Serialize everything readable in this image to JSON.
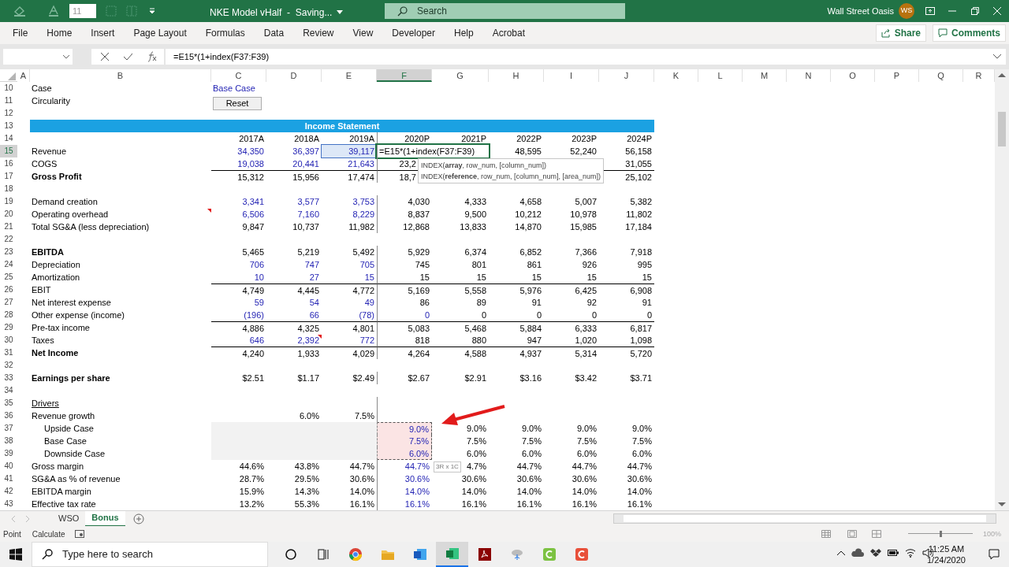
{
  "title_bar": {
    "font_size": "11",
    "title": "NKE Model vHalf  -  Saving...",
    "search": "Search",
    "user": "Wall Street Oasis",
    "initials": "WS"
  },
  "ribbon_tabs": [
    "File",
    "Home",
    "Insert",
    "Page Layout",
    "Formulas",
    "Data",
    "Review",
    "View",
    "Developer",
    "Help",
    "Acrobat"
  ],
  "ribbon_buttons": {
    "share": "Share",
    "comments": "Comments"
  },
  "formula_bar": {
    "formula": "=E15*(1+index(F37:F39)"
  },
  "columns": [
    {
      "letter": "A",
      "selected": false
    },
    {
      "letter": "B",
      "selected": false
    },
    {
      "letter": "C",
      "selected": false
    },
    {
      "letter": "D",
      "selected": false
    },
    {
      "letter": "E",
      "selected": false
    },
    {
      "letter": "F",
      "selected": true
    },
    {
      "letter": "G",
      "selected": false
    },
    {
      "letter": "H",
      "selected": false
    },
    {
      "letter": "I",
      "selected": false
    },
    {
      "letter": "J",
      "selected": false
    },
    {
      "letter": "K",
      "selected": false
    },
    {
      "letter": "L",
      "selected": false
    },
    {
      "letter": "M",
      "selected": false
    },
    {
      "letter": "N",
      "selected": false
    },
    {
      "letter": "O",
      "selected": false
    },
    {
      "letter": "P",
      "selected": false
    },
    {
      "letter": "Q",
      "selected": false
    },
    {
      "letter": "R",
      "selected": false
    }
  ],
  "rows": [
    {
      "n": "10",
      "selected": false,
      "kind": "setting",
      "label": "Case",
      "value": "Base Case"
    },
    {
      "n": "11",
      "selected": false,
      "kind": "button",
      "label": "Circularity",
      "button": "Reset"
    },
    {
      "n": "12",
      "selected": false,
      "kind": "blank"
    },
    {
      "n": "13",
      "selected": false,
      "kind": "banner",
      "title": "Income Statement"
    },
    {
      "n": "14",
      "selected": false,
      "kind": "data",
      "cells": [
        {
          "text": "2017A",
          "input": false
        },
        {
          "text": "2018A",
          "input": false
        },
        {
          "text": "2019A",
          "input": false
        },
        {
          "text": "2020P",
          "input": false
        },
        {
          "text": "2021P",
          "input": false
        },
        {
          "text": "2022P",
          "input": false
        },
        {
          "text": "2023P",
          "input": false
        },
        {
          "text": "2024P",
          "input": false
        }
      ]
    },
    {
      "n": "15",
      "selected": true,
      "kind": "data",
      "label": "Revenue",
      "cells": [
        {
          "text": "34,350",
          "input": true
        },
        {
          "text": "36,397",
          "input": true
        },
        {
          "text": "39,117",
          "input": true,
          "reference": true
        },
        {
          "text": "=E15*(1+index(F37:F39)",
          "input": false,
          "editing": true
        },
        null,
        {
          "text": "48,595",
          "input": false
        },
        {
          "text": "52,240",
          "input": false
        },
        {
          "text": "56,158",
          "input": false
        }
      ]
    },
    {
      "n": "16",
      "selected": false,
      "kind": "data",
      "label": "COGS",
      "cells": [
        {
          "text": "19,038",
          "input": true
        },
        {
          "text": "20,441",
          "input": true
        },
        {
          "text": "21,643",
          "input": true
        },
        {
          "text": "23,2",
          "input": false,
          "cut": true
        },
        null,
        null,
        null,
        {
          "text": "31,055",
          "input": false
        }
      ]
    },
    {
      "n": "17",
      "selected": false,
      "kind": "data",
      "label": "Gross Profit",
      "bold": true,
      "rule": true,
      "cells": [
        {
          "text": "15,312",
          "input": false
        },
        {
          "text": "15,956",
          "input": false
        },
        {
          "text": "17,474",
          "input": false
        },
        {
          "text": "18,7",
          "input": false,
          "cut": true
        },
        null,
        null,
        null,
        {
          "text": "25,102",
          "input": false
        }
      ]
    },
    {
      "n": "18",
      "selected": false,
      "kind": "blank"
    },
    {
      "n": "19",
      "selected": false,
      "kind": "data",
      "label": "Demand creation",
      "cells": [
        {
          "text": "3,341",
          "input": true
        },
        {
          "text": "3,577",
          "input": true
        },
        {
          "text": "3,753",
          "input": true
        },
        {
          "text": "4,030",
          "input": false
        },
        {
          "text": "4,333",
          "input": false
        },
        {
          "text": "4,658",
          "input": false
        },
        {
          "text": "5,007",
          "input": false
        },
        {
          "text": "5,382",
          "input": false
        }
      ]
    },
    {
      "n": "20",
      "selected": false,
      "kind": "data",
      "label": "Operating overhead",
      "label_note": true,
      "cells": [
        {
          "text": "6,506",
          "input": true
        },
        {
          "text": "7,160",
          "input": true
        },
        {
          "text": "8,229",
          "input": true
        },
        {
          "text": "8,837",
          "input": false
        },
        {
          "text": "9,500",
          "input": false
        },
        {
          "text": "10,212",
          "input": false
        },
        {
          "text": "10,978",
          "input": false
        },
        {
          "text": "11,802",
          "input": false
        }
      ]
    },
    {
      "n": "21",
      "selected": false,
      "kind": "data",
      "label": "Total SG&A (less depreciation)",
      "cells": [
        {
          "text": "9,847",
          "input": false
        },
        {
          "text": "10,737",
          "input": false
        },
        {
          "text": "11,982",
          "input": false
        },
        {
          "text": "12,868",
          "input": false
        },
        {
          "text": "13,833",
          "input": false
        },
        {
          "text": "14,870",
          "input": false
        },
        {
          "text": "15,985",
          "input": false
        },
        {
          "text": "17,184",
          "input": false
        }
      ]
    },
    {
      "n": "22",
      "selected": false,
      "kind": "blank"
    },
    {
      "n": "23",
      "selected": false,
      "kind": "data",
      "label": "EBITDA",
      "bold": true,
      "cells": [
        {
          "text": "5,465",
          "input": false
        },
        {
          "text": "5,219",
          "input": false
        },
        {
          "text": "5,492",
          "input": false
        },
        {
          "text": "5,929",
          "input": false
        },
        {
          "text": "6,374",
          "input": false
        },
        {
          "text": "6,852",
          "input": false
        },
        {
          "text": "7,366",
          "input": false
        },
        {
          "text": "7,918",
          "input": false
        }
      ]
    },
    {
      "n": "24",
      "selected": false,
      "kind": "data",
      "label": "Depreciation",
      "cells": [
        {
          "text": "706",
          "input": true
        },
        {
          "text": "747",
          "input": true
        },
        {
          "text": "705",
          "input": true
        },
        {
          "text": "745",
          "input": false
        },
        {
          "text": "801",
          "input": false
        },
        {
          "text": "861",
          "input": false
        },
        {
          "text": "926",
          "input": false
        },
        {
          "text": "995",
          "input": false
        }
      ]
    },
    {
      "n": "25",
      "selected": false,
      "kind": "data",
      "label": "Amortization",
      "cells": [
        {
          "text": "10",
          "input": true
        },
        {
          "text": "27",
          "input": true
        },
        {
          "text": "15",
          "input": true
        },
        {
          "text": "15",
          "input": false
        },
        {
          "text": "15",
          "input": false
        },
        {
          "text": "15",
          "input": false
        },
        {
          "text": "15",
          "input": false
        },
        {
          "text": "15",
          "input": false
        }
      ]
    },
    {
      "n": "26",
      "selected": false,
      "kind": "data",
      "label": "EBIT",
      "rule": true,
      "cells": [
        {
          "text": "4,749",
          "input": false
        },
        {
          "text": "4,445",
          "input": false
        },
        {
          "text": "4,772",
          "input": false
        },
        {
          "text": "5,169",
          "input": false
        },
        {
          "text": "5,558",
          "input": false
        },
        {
          "text": "5,976",
          "input": false
        },
        {
          "text": "6,425",
          "input": false
        },
        {
          "text": "6,908",
          "input": false
        }
      ]
    },
    {
      "n": "27",
      "selected": false,
      "kind": "data",
      "label": "Net interest expense",
      "cells": [
        {
          "text": "59",
          "input": true
        },
        {
          "text": "54",
          "input": true
        },
        {
          "text": "49",
          "input": true
        },
        {
          "text": "86",
          "input": false
        },
        {
          "text": "89",
          "input": false
        },
        {
          "text": "91",
          "input": false
        },
        {
          "text": "92",
          "input": false
        },
        {
          "text": "91",
          "input": false
        }
      ]
    },
    {
      "n": "28",
      "selected": false,
      "kind": "data",
      "label": "Other expense (income)",
      "cells": [
        {
          "text": "(196)",
          "input": true
        },
        {
          "text": "66",
          "input": true
        },
        {
          "text": "(78)",
          "input": true
        },
        {
          "text": "0",
          "input": true
        },
        {
          "text": "0",
          "input": false
        },
        {
          "text": "0",
          "input": false
        },
        {
          "text": "0",
          "input": false
        },
        {
          "text": "0",
          "input": false
        }
      ]
    },
    {
      "n": "29",
      "selected": false,
      "kind": "data",
      "label": "Pre-tax income",
      "rule": true,
      "cells": [
        {
          "text": "4,886",
          "input": false
        },
        {
          "text": "4,325",
          "input": false
        },
        {
          "text": "4,801",
          "input": false
        },
        {
          "text": "5,083",
          "input": false
        },
        {
          "text": "5,468",
          "input": false
        },
        {
          "text": "5,884",
          "input": false
        },
        {
          "text": "6,333",
          "input": false
        },
        {
          "text": "6,817",
          "input": false
        }
      ]
    },
    {
      "n": "30",
      "selected": false,
      "kind": "data",
      "label": "Taxes",
      "cells": [
        {
          "text": "646",
          "input": true
        },
        {
          "text": "2,392",
          "input": true,
          "note": true
        },
        {
          "text": "772",
          "input": true
        },
        {
          "text": "818",
          "input": false
        },
        {
          "text": "880",
          "input": false
        },
        {
          "text": "947",
          "input": false
        },
        {
          "text": "1,020",
          "input": false
        },
        {
          "text": "1,098",
          "input": false
        }
      ]
    },
    {
      "n": "31",
      "selected": false,
      "kind": "data",
      "label": "Net Income",
      "bold": true,
      "rule": true,
      "cells": [
        {
          "text": "4,240",
          "input": false
        },
        {
          "text": "1,933",
          "input": false
        },
        {
          "text": "4,029",
          "input": false
        },
        {
          "text": "4,264",
          "input": false
        },
        {
          "text": "4,588",
          "input": false
        },
        {
          "text": "4,937",
          "input": false
        },
        {
          "text": "5,314",
          "input": false
        },
        {
          "text": "5,720",
          "input": false
        }
      ]
    },
    {
      "n": "32",
      "selected": false,
      "kind": "blank"
    },
    {
      "n": "33",
      "selected": false,
      "kind": "data",
      "label": "Earnings per share",
      "bold": true,
      "cells": [
        {
          "text": "$2.51",
          "input": false
        },
        {
          "text": "$1.17",
          "input": false
        },
        {
          "text": "$2.49",
          "input": false
        },
        {
          "text": "$2.67",
          "input": false
        },
        {
          "text": "$2.91",
          "input": false
        },
        {
          "text": "$3.16",
          "input": false
        },
        {
          "text": "$3.42",
          "input": false
        },
        {
          "text": "$3.71",
          "input": false
        }
      ]
    },
    {
      "n": "34",
      "selected": false,
      "kind": "blank"
    },
    {
      "n": "35",
      "selected": false,
      "kind": "heading",
      "label": "Drivers"
    },
    {
      "n": "36",
      "selected": false,
      "kind": "data",
      "label": "Revenue growth",
      "cells": [
        null,
        {
          "text": "6.0%",
          "input": false
        },
        {
          "text": "7.5%",
          "input": false
        }
      ]
    },
    {
      "n": "37",
      "selected": false,
      "kind": "scenario",
      "label": "Upside Case",
      "in_range": true,
      "cells": [
        null,
        null,
        null,
        {
          "text": "9.0%",
          "input": true
        },
        {
          "text": "9.0%",
          "input": false
        },
        {
          "text": "9.0%",
          "input": false
        },
        {
          "text": "9.0%",
          "input": false
        },
        {
          "text": "9.0%",
          "input": false
        }
      ]
    },
    {
      "n": "38",
      "selected": false,
      "kind": "scenario",
      "label": "Base Case",
      "in_range": true,
      "cells": [
        null,
        null,
        null,
        {
          "text": "7.5%",
          "input": true
        },
        {
          "text": "7.5%",
          "input": false
        },
        {
          "text": "7.5%",
          "input": false
        },
        {
          "text": "7.5%",
          "input": false
        },
        {
          "text": "7.5%",
          "input": false
        }
      ]
    },
    {
      "n": "39",
      "selected": false,
      "kind": "scenario",
      "label": "Downside Case",
      "in_range": true,
      "cells": [
        null,
        null,
        null,
        {
          "text": "6.0%",
          "input": true
        },
        {
          "text": "6.0%",
          "input": false
        },
        {
          "text": "6.0%",
          "input": false
        },
        {
          "text": "6.0%",
          "input": false
        },
        {
          "text": "6.0%",
          "input": false
        }
      ]
    },
    {
      "n": "40",
      "selected": false,
      "kind": "data",
      "label": "Gross margin",
      "cells": [
        {
          "text": "44.6%",
          "input": false
        },
        {
          "text": "43.8%",
          "input": false
        },
        {
          "text": "44.7%",
          "input": false
        },
        {
          "text": "44.7%",
          "input": true
        },
        {
          "text": "4.7%",
          "input": false
        },
        {
          "text": "44.7%",
          "input": false
        },
        {
          "text": "44.7%",
          "input": false
        },
        {
          "text": "44.7%",
          "input": false
        }
      ]
    },
    {
      "n": "41",
      "selected": false,
      "kind": "data",
      "label": "SG&A as % of revenue",
      "cells": [
        {
          "text": "28.7%",
          "input": false
        },
        {
          "text": "29.5%",
          "input": false
        },
        {
          "text": "30.6%",
          "input": false
        },
        {
          "text": "30.6%",
          "input": true
        },
        {
          "text": "30.6%",
          "input": false
        },
        {
          "text": "30.6%",
          "input": false
        },
        {
          "text": "30.6%",
          "input": false
        },
        {
          "text": "30.6%",
          "input": false
        }
      ]
    },
    {
      "n": "42",
      "selected": false,
      "kind": "data",
      "label": "EBITDA margin",
      "cells": [
        {
          "text": "15.9%",
          "input": false
        },
        {
          "text": "14.3%",
          "input": false
        },
        {
          "text": "14.0%",
          "input": false
        },
        {
          "text": "14.0%",
          "input": true
        },
        {
          "text": "14.0%",
          "input": false
        },
        {
          "text": "14.0%",
          "input": false
        },
        {
          "text": "14.0%",
          "input": false
        },
        {
          "text": "14.0%",
          "input": false
        }
      ]
    },
    {
      "n": "43",
      "selected": false,
      "kind": "data",
      "label": "Effective tax rate",
      "cells": [
        {
          "text": "13.2%",
          "input": false
        },
        {
          "text": "55.3%",
          "input": false
        },
        {
          "text": "16.1%",
          "input": false
        },
        {
          "text": "16.1%",
          "input": true
        },
        {
          "text": "16.1%",
          "input": false
        },
        {
          "text": "16.1%",
          "input": false
        },
        {
          "text": "16.1%",
          "input": false
        },
        {
          "text": "16.1%",
          "input": false
        }
      ]
    }
  ],
  "function_tooltip": [
    "INDEX(**array**, row_num, [column_num])",
    "INDEX(**reference**, row_num, [column_num], [area_num])"
  ],
  "range_tooltip": "3R x 1C",
  "sheet_tabs": [
    {
      "label": "WSO",
      "selected": false
    },
    {
      "label": "Bonus",
      "selected": true
    }
  ],
  "status_bar": {
    "mode": "Point",
    "calc": "Calculate",
    "zoom": "100%",
    "zoom_slider": {
      "level": 0.5
    }
  },
  "taskbar": {
    "search": "Type here to search",
    "apps": [
      {
        "kind": "cortana",
        "active": false
      },
      {
        "kind": "taskview",
        "active": false
      },
      {
        "kind": "browser",
        "active": false
      },
      {
        "kind": "folder",
        "active": false
      },
      {
        "kind": "word",
        "active": false
      },
      {
        "kind": "excel",
        "active": true
      },
      {
        "kind": "pdf",
        "active": false
      },
      {
        "kind": "feather",
        "active": false
      },
      {
        "kind": "greenc",
        "active": false
      },
      {
        "kind": "redc",
        "active": false
      }
    ],
    "time": "11:25 AM",
    "date": "1/24/2020"
  }
}
